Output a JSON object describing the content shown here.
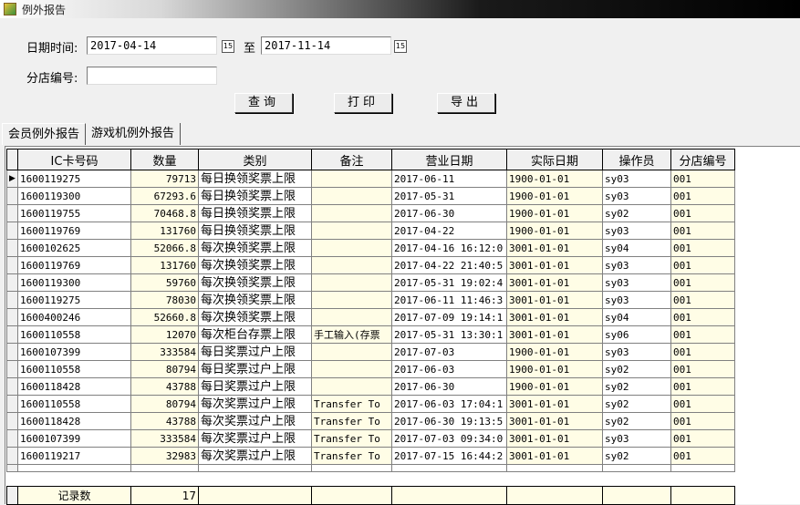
{
  "window": {
    "title": "例外报告"
  },
  "filters": {
    "date_label": "日期时间:",
    "date_from": "2017-04-14",
    "to_label": "至",
    "date_to": "2017-11-14",
    "calendar_icon_text": "15",
    "branch_label": "分店编号:",
    "branch_value": ""
  },
  "buttons": {
    "query": "查询",
    "print": "打印",
    "export": "导出"
  },
  "tabs": [
    "会员例外报告",
    "游戏机例外报告"
  ],
  "table": {
    "columns": [
      "IC卡号码",
      "数量",
      "类别",
      "备注",
      "营业日期",
      "实际日期",
      "操作员",
      "分店编号"
    ],
    "rows": [
      [
        "1600119275",
        "79713",
        "每日换领奖票上限",
        "",
        "2017-06-11",
        "1900-01-01",
        "sy03",
        "001"
      ],
      [
        "1600119300",
        "67293.6",
        "每日换领奖票上限",
        "",
        "2017-05-31",
        "1900-01-01",
        "sy03",
        "001"
      ],
      [
        "1600119755",
        "70468.8",
        "每日换领奖票上限",
        "",
        "2017-06-30",
        "1900-01-01",
        "sy02",
        "001"
      ],
      [
        "1600119769",
        "131760",
        "每日换领奖票上限",
        "",
        "2017-04-22",
        "1900-01-01",
        "sy03",
        "001"
      ],
      [
        "1600102625",
        "52066.8",
        "每次换领奖票上限",
        "",
        "2017-04-16 16:12:0",
        "3001-01-01",
        "sy04",
        "001"
      ],
      [
        "1600119769",
        "131760",
        "每次换领奖票上限",
        "",
        "2017-04-22 21:40:5",
        "3001-01-01",
        "sy03",
        "001"
      ],
      [
        "1600119300",
        "59760",
        "每次换领奖票上限",
        "",
        "2017-05-31 19:02:4",
        "3001-01-01",
        "sy03",
        "001"
      ],
      [
        "1600119275",
        "78030",
        "每次换领奖票上限",
        "",
        "2017-06-11 11:46:3",
        "3001-01-01",
        "sy03",
        "001"
      ],
      [
        "1600400246",
        "52660.8",
        "每次换领奖票上限",
        "",
        "2017-07-09 19:14:1",
        "3001-01-01",
        "sy04",
        "001"
      ],
      [
        "1600110558",
        "12070",
        "每次柜台存票上限",
        "手工输入(存票",
        "2017-05-31 13:30:1",
        "3001-01-01",
        "sy06",
        "001"
      ],
      [
        "1600107399",
        "333584",
        "每日奖票过户上限",
        "",
        "2017-07-03",
        "1900-01-01",
        "sy03",
        "001"
      ],
      [
        "1600110558",
        "80794",
        "每日奖票过户上限",
        "",
        "2017-06-03",
        "1900-01-01",
        "sy02",
        "001"
      ],
      [
        "1600118428",
        "43788",
        "每日奖票过户上限",
        "",
        "2017-06-30",
        "1900-01-01",
        "sy02",
        "001"
      ],
      [
        "1600110558",
        "80794",
        "每次奖票过户上限",
        "Transfer To",
        "2017-06-03 17:04:1",
        "3001-01-01",
        "sy02",
        "001"
      ],
      [
        "1600118428",
        "43788",
        "每次奖票过户上限",
        "Transfer To",
        "2017-06-30 19:13:5",
        "3001-01-01",
        "sy02",
        "001"
      ],
      [
        "1600107399",
        "333584",
        "每次奖票过户上限",
        "Transfer To",
        "2017-07-03 09:34:0",
        "3001-01-01",
        "sy03",
        "001"
      ],
      [
        "1600119217",
        "32983",
        "每次奖票过户上限",
        "Transfer To",
        "2017-07-15 16:44:2",
        "3001-01-01",
        "sy02",
        "001"
      ]
    ]
  },
  "footer": {
    "label": "记录数",
    "count": "17"
  }
}
